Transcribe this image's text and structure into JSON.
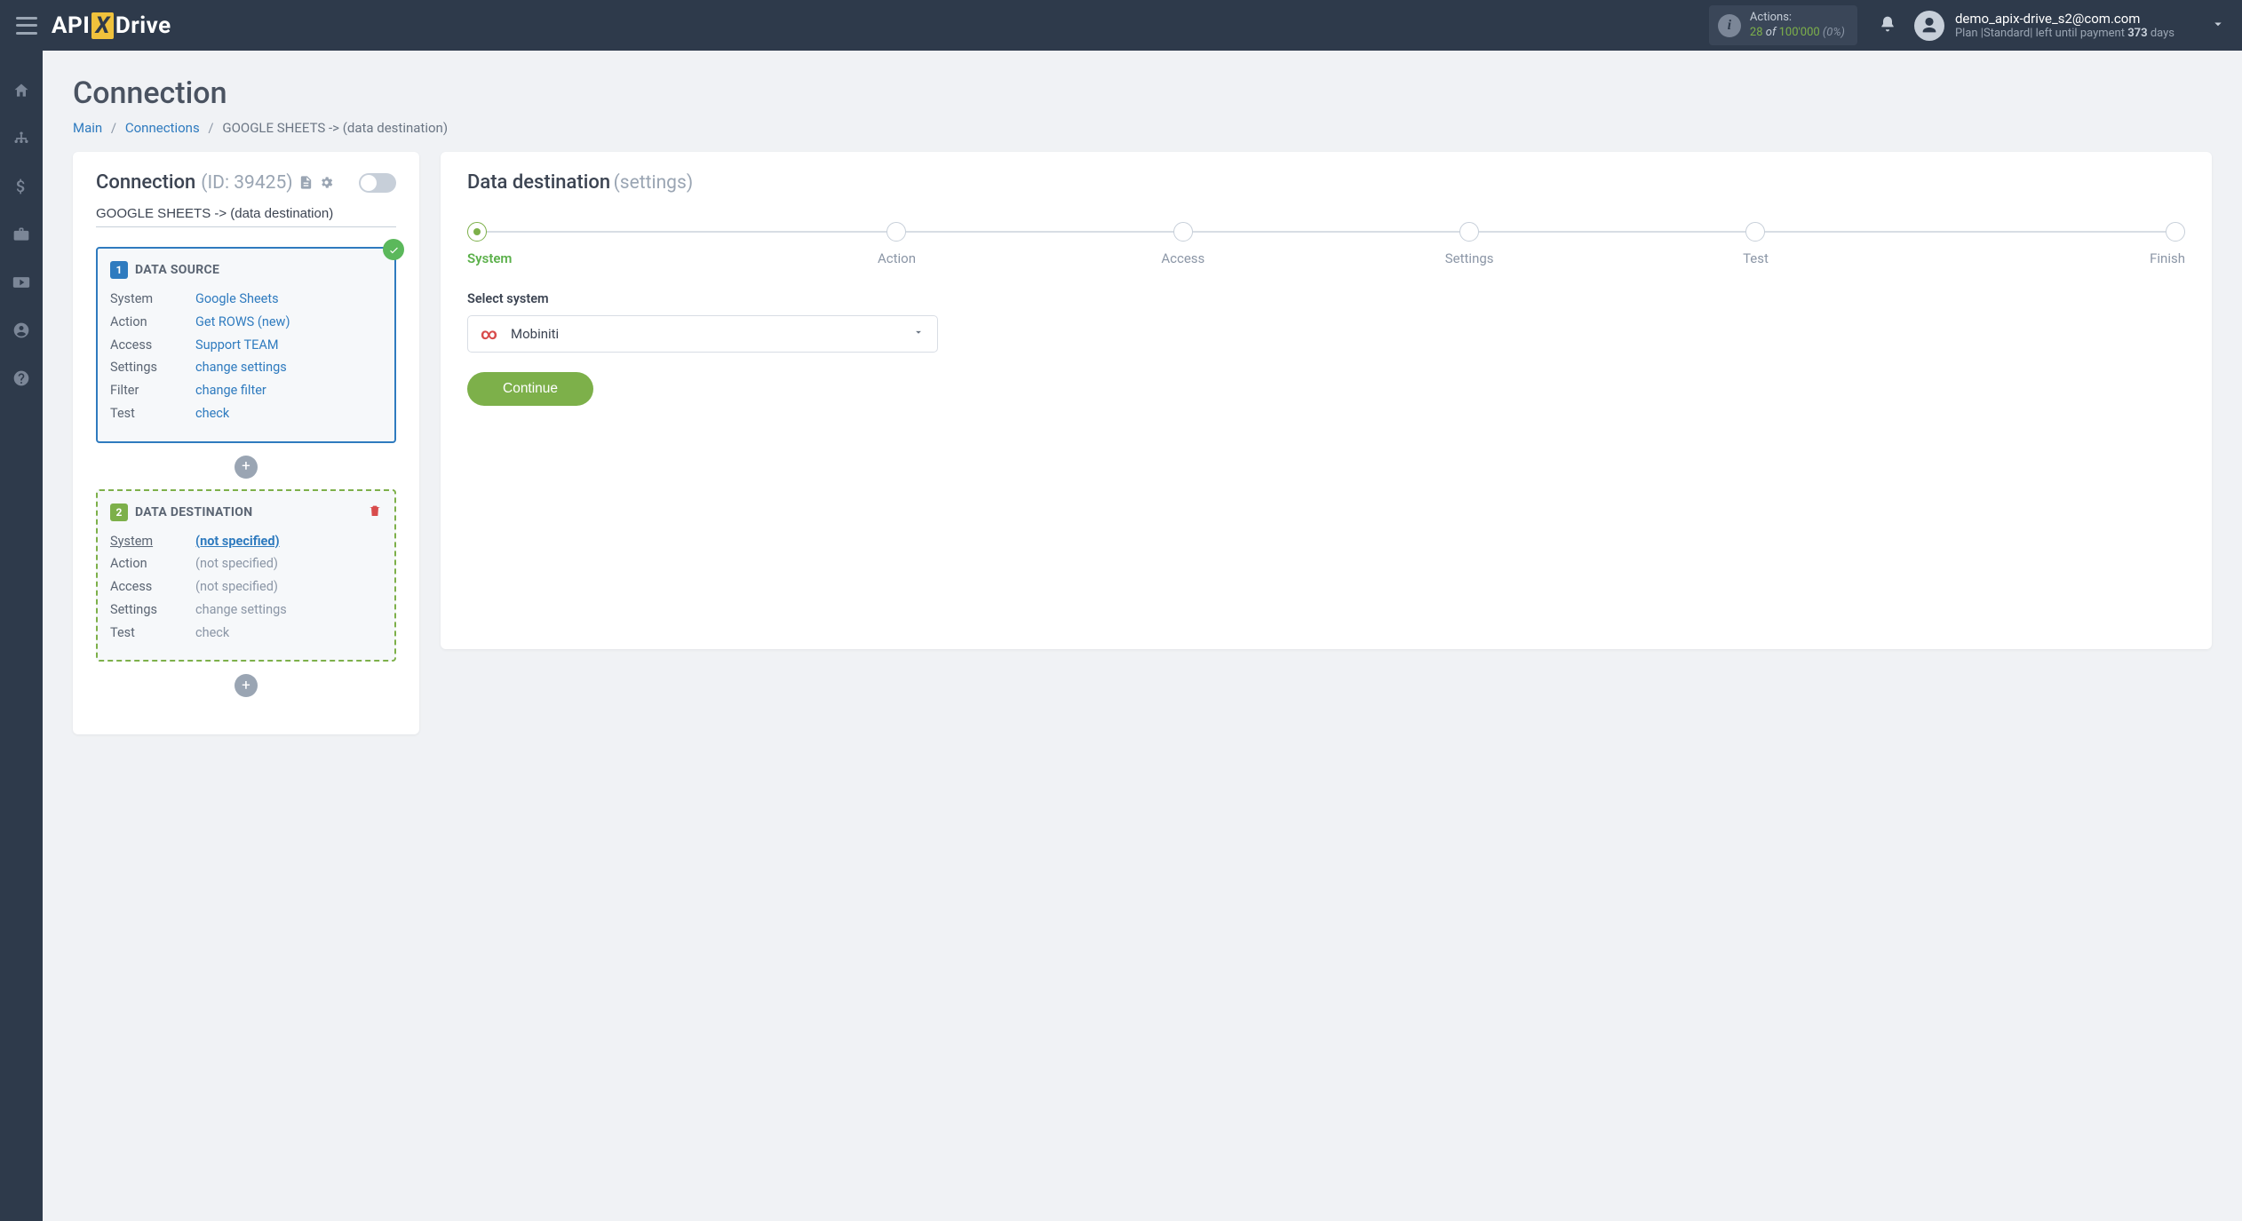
{
  "header": {
    "actions": {
      "label": "Actions:",
      "used": "28",
      "of": "of",
      "limit": "100'000",
      "pct": "(0%)"
    },
    "user": {
      "email": "demo_apix-drive_s2@com.com",
      "plan_prefix": "Plan ",
      "plan_name": "|Standard|",
      "plan_mid": " left until payment ",
      "days": "373",
      "plan_suffix": " days"
    }
  },
  "breadcrumb": {
    "main": "Main",
    "connections": "Connections",
    "current": "GOOGLE SHEETS -> (data destination)"
  },
  "page_title": "Connection",
  "left": {
    "title": "Connection",
    "id_label": "(ID: 39425)",
    "name_value": "GOOGLE SHEETS -> (data destination)",
    "source": {
      "title": "DATA SOURCE",
      "num": "1",
      "rows": [
        {
          "k": "System",
          "v": "Google Sheets"
        },
        {
          "k": "Action",
          "v": "Get ROWS (new)"
        },
        {
          "k": "Access",
          "v": "Support TEAM"
        },
        {
          "k": "Settings",
          "v": "change settings"
        },
        {
          "k": "Filter",
          "v": "change filter"
        },
        {
          "k": "Test",
          "v": "check"
        }
      ]
    },
    "dest": {
      "title": "DATA DESTINATION",
      "num": "2",
      "rows": [
        {
          "k": "System",
          "v": "(not specified)",
          "active": true
        },
        {
          "k": "Action",
          "v": "(not specified)"
        },
        {
          "k": "Access",
          "v": "(not specified)"
        },
        {
          "k": "Settings",
          "v": "change settings"
        },
        {
          "k": "Test",
          "v": "check"
        }
      ]
    }
  },
  "right": {
    "title": "Data destination",
    "subtitle": "(settings)",
    "steps": [
      "System",
      "Action",
      "Access",
      "Settings",
      "Test",
      "Finish"
    ],
    "active_step": 0,
    "select_label": "Select system",
    "selected_system": "Mobiniti",
    "continue_label": "Continue"
  }
}
